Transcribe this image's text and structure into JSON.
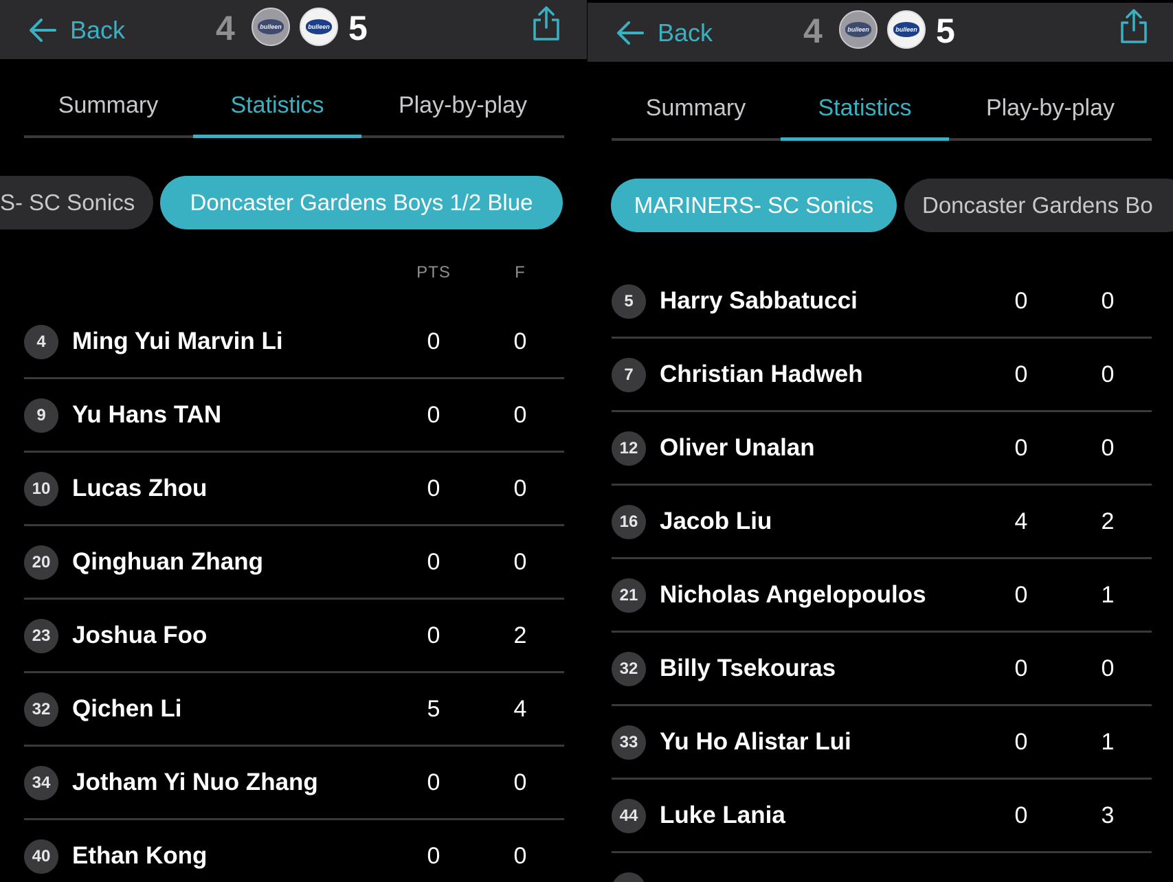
{
  "header": {
    "back_label": "Back",
    "home_score": "4",
    "away_score": "5",
    "logo_text": "bulleen",
    "accent_color": "#3ab1c3"
  },
  "tabs": [
    "Summary",
    "Statistics",
    "Play-by-play"
  ],
  "left_panel": {
    "team_pills": [
      "S- SC Sonics",
      "Doncaster Gardens Boys 1/2 Blue"
    ],
    "columns": [
      "PTS",
      "F"
    ],
    "players": [
      {
        "number": "4",
        "name": "Ming Yui Marvin Li",
        "pts": "0",
        "f": "0"
      },
      {
        "number": "9",
        "name": "Yu Hans TAN",
        "pts": "0",
        "f": "0"
      },
      {
        "number": "10",
        "name": "Lucas Zhou",
        "pts": "0",
        "f": "0"
      },
      {
        "number": "20",
        "name": "Qinghuan Zhang",
        "pts": "0",
        "f": "0"
      },
      {
        "number": "23",
        "name": "Joshua Foo",
        "pts": "0",
        "f": "2"
      },
      {
        "number": "32",
        "name": "Qichen Li",
        "pts": "5",
        "f": "4"
      },
      {
        "number": "34",
        "name": "Jotham Yi Nuo Zhang",
        "pts": "0",
        "f": "0"
      },
      {
        "number": "40",
        "name": "Ethan Kong",
        "pts": "0",
        "f": "0"
      }
    ]
  },
  "right_panel": {
    "team_pills": [
      "MARINERS- SC Sonics",
      "Doncaster Gardens Bo"
    ],
    "players": [
      {
        "number": "5",
        "name": "Harry Sabbatucci",
        "pts": "0",
        "f": "0"
      },
      {
        "number": "7",
        "name": "Christian Hadweh",
        "pts": "0",
        "f": "0"
      },
      {
        "number": "12",
        "name": "Oliver Unalan",
        "pts": "0",
        "f": "0"
      },
      {
        "number": "16",
        "name": "Jacob Liu",
        "pts": "4",
        "f": "2"
      },
      {
        "number": "21",
        "name": "Nicholas Angelopoulos",
        "pts": "0",
        "f": "1"
      },
      {
        "number": "32",
        "name": "Billy Tsekouras",
        "pts": "0",
        "f": "0"
      },
      {
        "number": "33",
        "name": "Yu Ho Alistar Lui",
        "pts": "0",
        "f": "1"
      },
      {
        "number": "44",
        "name": "Luke Lania",
        "pts": "0",
        "f": "3"
      }
    ]
  }
}
